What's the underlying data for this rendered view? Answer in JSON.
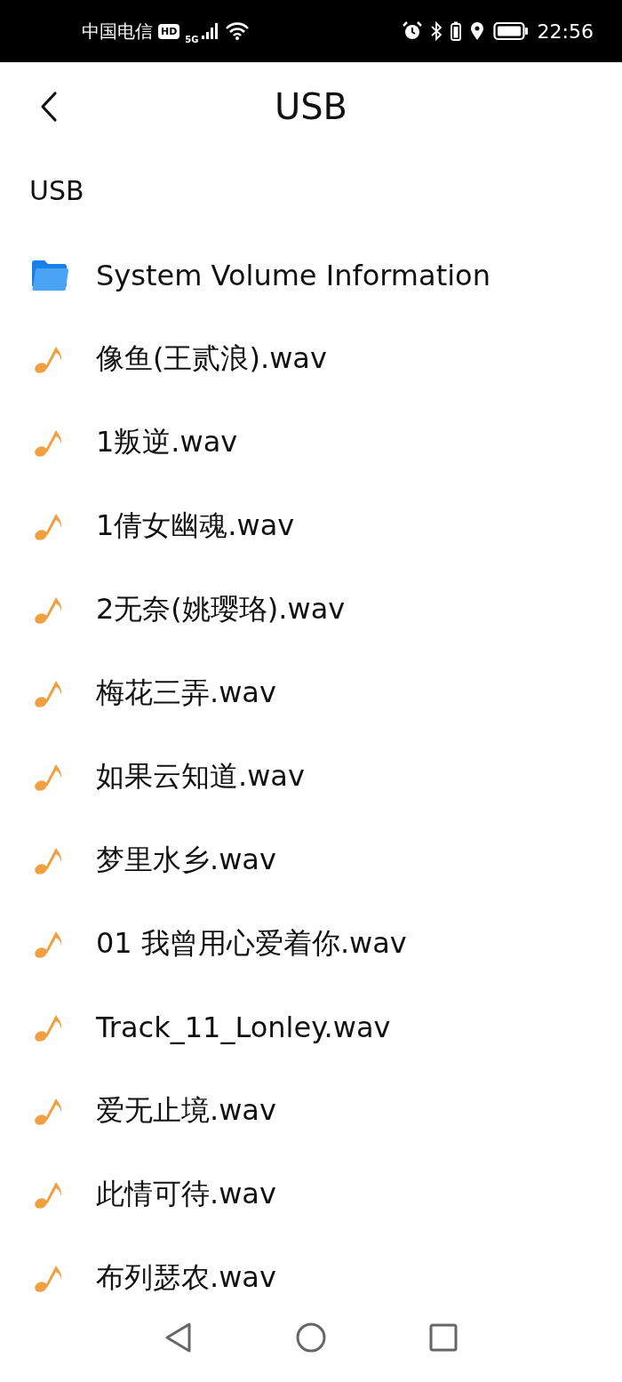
{
  "status_bar": {
    "carrier": "中国电信",
    "hd_badge": "HD",
    "network": "5G",
    "time": "22:56"
  },
  "header": {
    "title": "USB"
  },
  "path": "USB",
  "files": [
    {
      "name": "System Volume Information",
      "kind": "folder"
    },
    {
      "name": "像鱼(王贰浪).wav",
      "kind": "audio"
    },
    {
      "name": "1叛逆.wav",
      "kind": "audio"
    },
    {
      "name": "1倩女幽魂.wav",
      "kind": "audio"
    },
    {
      "name": "2无奈(姚璎珞).wav",
      "kind": "audio"
    },
    {
      "name": "梅花三弄.wav",
      "kind": "audio"
    },
    {
      "name": "如果云知道.wav",
      "kind": "audio"
    },
    {
      "name": "梦里水乡.wav",
      "kind": "audio"
    },
    {
      "name": "01 我曾用心爱着你.wav",
      "kind": "audio"
    },
    {
      "name": "Track_11_Lonley.wav",
      "kind": "audio"
    },
    {
      "name": "爱无止境.wav",
      "kind": "audio"
    },
    {
      "name": "此情可待.wav",
      "kind": "audio"
    },
    {
      "name": "布列瑟农.wav",
      "kind": "audio"
    }
  ]
}
